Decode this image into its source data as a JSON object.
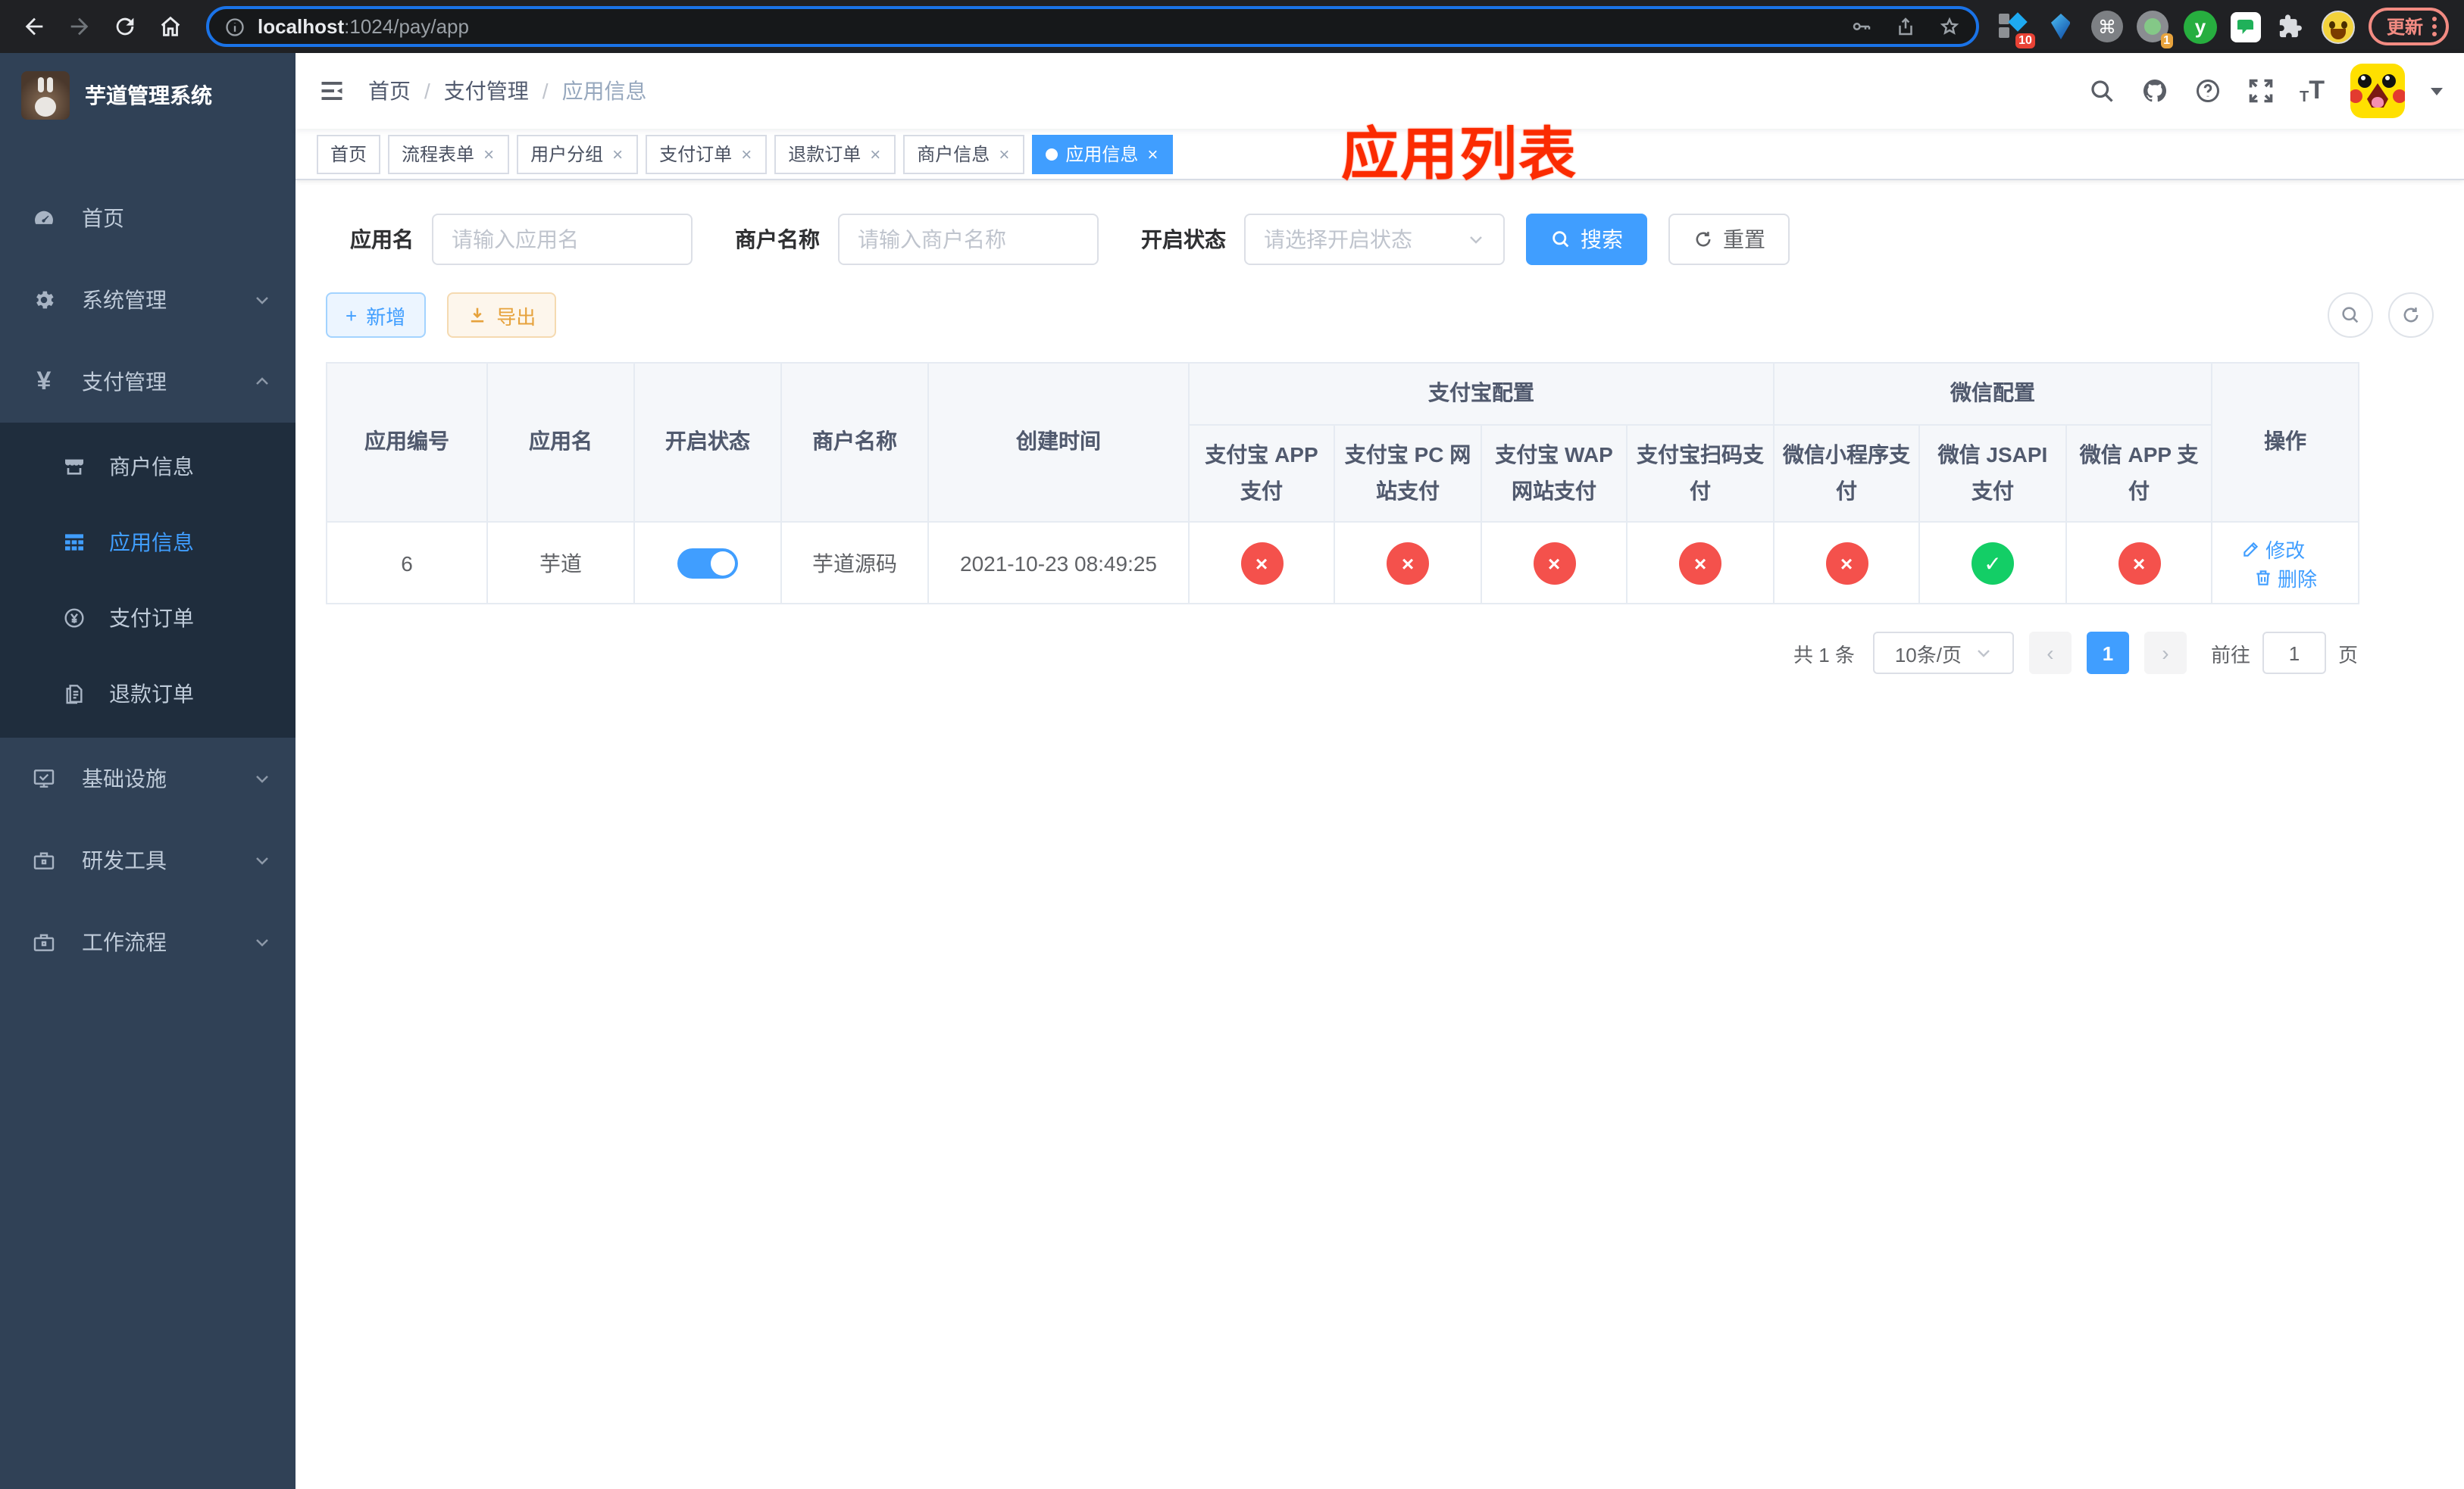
{
  "colors": {
    "accent": "#409EFF",
    "success": "#13CE66",
    "danger": "#F4514C",
    "warning": "#E6A23C",
    "annotation": "#FB2B01",
    "sidebar_bg": "#304156",
    "submenu_bg": "#1F2D3D"
  },
  "icons": {
    "close": "×",
    "check": "✓",
    "cross": "×",
    "prev": "‹",
    "next": "›",
    "cmd": "⌘",
    "plus": "+",
    "font_small": "T",
    "font_big": "T",
    "help": "?",
    "yen": "¥"
  },
  "browser": {
    "url_host": "localhost",
    "url_rest": ":1024/pay/app",
    "ext_badge_blocks": "10",
    "ext_badge_cam": "1",
    "ext_letter": "y",
    "update_label": "更新"
  },
  "sidebar": {
    "title": "芋道管理系统",
    "items_top": [
      {
        "label": "首页"
      },
      {
        "label": "系统管理"
      },
      {
        "label": "支付管理"
      }
    ],
    "submenu": [
      {
        "label": "商户信息"
      },
      {
        "label": "应用信息"
      },
      {
        "label": "支付订单"
      },
      {
        "label": "退款订单"
      }
    ],
    "items_bottom": [
      {
        "label": "基础设施"
      },
      {
        "label": "研发工具"
      },
      {
        "label": "工作流程"
      }
    ]
  },
  "navbar": {
    "breadcrumb": [
      "首页",
      "支付管理",
      "应用信息"
    ],
    "separator": "/"
  },
  "annotation": {
    "text": "应用列表"
  },
  "tags": [
    {
      "label": "首页"
    },
    {
      "label": "流程表单"
    },
    {
      "label": "用户分组"
    },
    {
      "label": "支付订单"
    },
    {
      "label": "退款订单"
    },
    {
      "label": "商户信息"
    },
    {
      "label": "应用信息"
    }
  ],
  "search": {
    "app_name_label": "应用名",
    "app_name_placeholder": "请输入应用名",
    "merchant_label": "商户名称",
    "merchant_placeholder": "请输入商户名称",
    "status_label": "开启状态",
    "status_placeholder": "请选择开启状态",
    "search_button": "搜索",
    "reset_button": "重置"
  },
  "toolbar": {
    "add_label": "新增",
    "export_label": "导出"
  },
  "table": {
    "headers": {
      "app_id": "应用编号",
      "app_name": "应用名",
      "status": "开启状态",
      "merchant": "商户名称",
      "created": "创建时间",
      "alipay_group": "支付宝配置",
      "wechat_group": "微信配置",
      "alipay_app": "支付宝 APP 支付",
      "alipay_pc": "支付宝 PC 网站支付",
      "alipay_wap": "支付宝 WAP 网站支付",
      "alipay_qr": "支付宝扫码支付",
      "wx_lite": "微信小程序支付",
      "wx_jsapi": "微信 JSAPI 支付",
      "wx_app": "微信 APP 支付",
      "ops": "操作"
    },
    "row": {
      "id": "6",
      "name": "芋道",
      "merchant": "芋道源码",
      "created": "2021-10-23 08:49:25",
      "configs": {
        "alipay_app": "no",
        "alipay_pc": "no",
        "alipay_wap": "no",
        "alipay_qr": "no",
        "wx_lite": "no",
        "wx_jsapi": "yes",
        "wx_app": "no"
      },
      "edit_label": "修改",
      "delete_label": "删除"
    }
  },
  "pagination": {
    "total_label": "共 1 条",
    "page_size_label": "10条/页",
    "current_page": "1",
    "goto_label": "前往",
    "goto_value": "1",
    "page_suffix": "页"
  }
}
